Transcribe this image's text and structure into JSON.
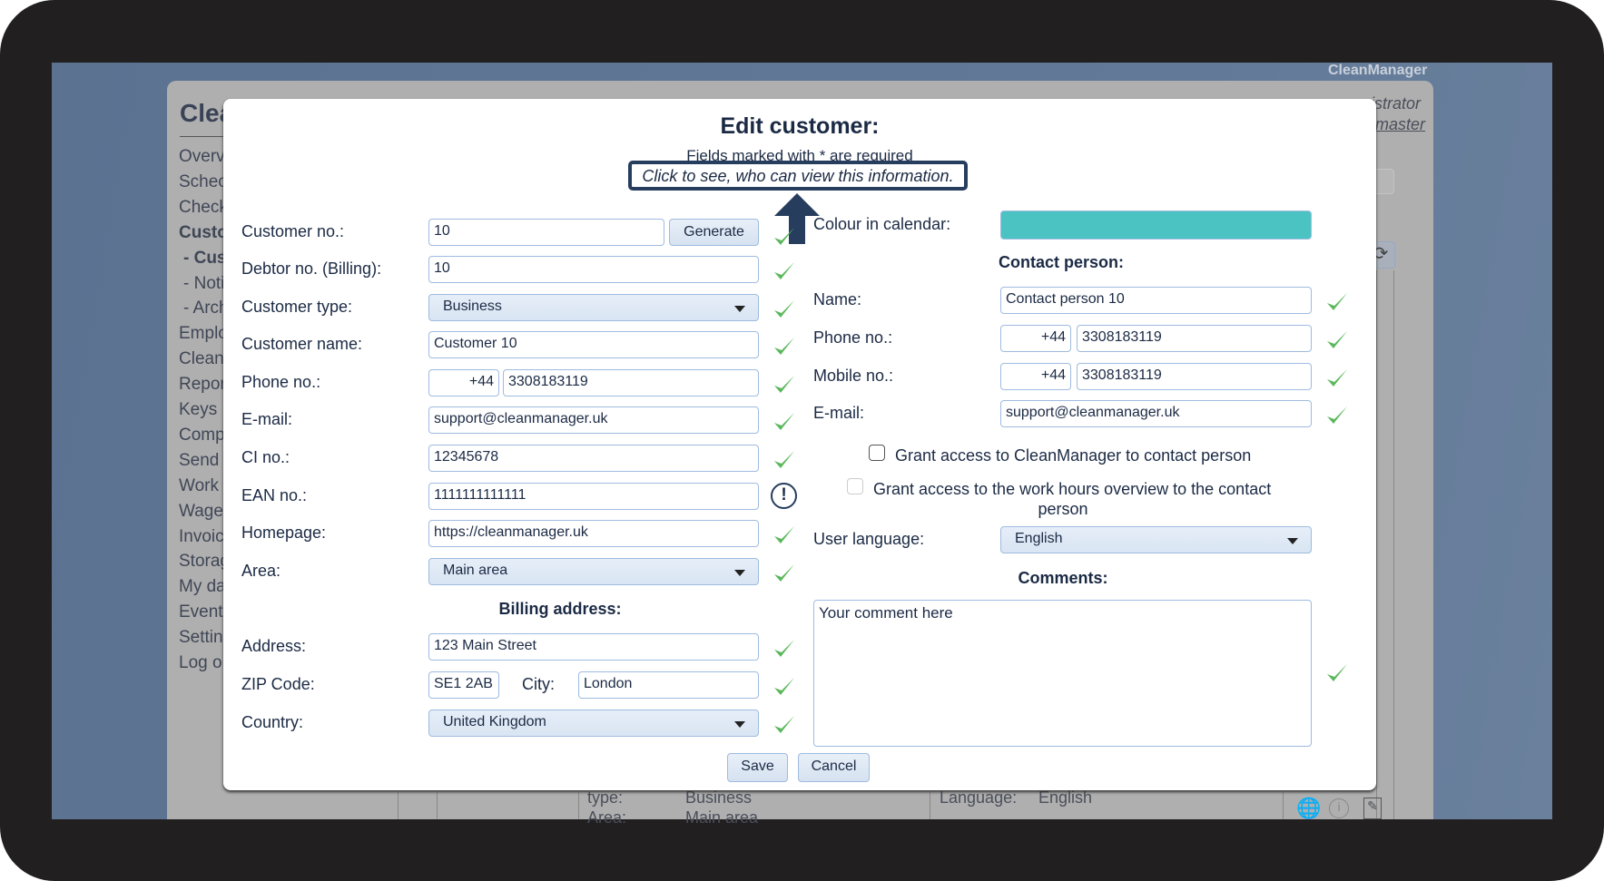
{
  "app": {
    "brand": "CleanManager",
    "window_title": "Clea",
    "user_line1": "istrator",
    "user_line2": "master"
  },
  "sidebar": {
    "items": [
      "Overv",
      "Schec",
      "Check",
      "Custo",
      "- Cus",
      "- Noti",
      "- Arch",
      "Emplo",
      "Clean",
      "Repor",
      "Keys",
      "Comp",
      "Send",
      "Work",
      "Wage",
      "Invoic",
      "Storag",
      "My da",
      "Event",
      "Settin",
      "Log o"
    ]
  },
  "background_row": {
    "type_label": "type:",
    "type_value": "Business",
    "area_label": "Area:",
    "area_value": "Main area",
    "language_label": "Language:",
    "language_value": "English"
  },
  "dialog": {
    "title": "Edit customer:",
    "subtitle": "Fields marked with * are required",
    "tooltip": "Click to see, who can view this information.",
    "left": {
      "customer_no": {
        "label": "Customer no.:",
        "value": "10",
        "button": "Generate"
      },
      "debtor_no": {
        "label": "Debtor no. (Billing):",
        "value": "10"
      },
      "customer_type": {
        "label": "Customer type:",
        "value": "Business"
      },
      "customer_name": {
        "label": "Customer name:",
        "value": "Customer 10"
      },
      "phone": {
        "label": "Phone no.:",
        "prefix": "+44",
        "value": "3308183119"
      },
      "email": {
        "label": "E-mail:",
        "value": "support@cleanmanager.uk"
      },
      "ci_no": {
        "label": "CI no.:",
        "value": "12345678"
      },
      "ean_no": {
        "label": "EAN no.:",
        "value": "1111111111111"
      },
      "homepage": {
        "label": "Homepage:",
        "value": "https://cleanmanager.uk"
      },
      "area": {
        "label": "Area:",
        "value": "Main area"
      },
      "billing_heading": "Billing address:",
      "address": {
        "label": "Address:",
        "value": "123 Main Street"
      },
      "zip": {
        "label": "ZIP Code:",
        "value": "SE1 2AB",
        "city_label": "City:",
        "city_value": "London"
      },
      "country": {
        "label": "Country:",
        "value": "United Kingdom"
      }
    },
    "right": {
      "colour": {
        "label": "Colour in calendar:",
        "value": "#4cc3c3"
      },
      "contact_heading": "Contact person:",
      "name": {
        "label": "Name:",
        "value": "Contact person 10"
      },
      "phone": {
        "label": "Phone no.:",
        "prefix": "+44",
        "value": "3308183119"
      },
      "mobile": {
        "label": "Mobile no.:",
        "prefix": "+44",
        "value": "3308183119"
      },
      "email": {
        "label": "E-mail:",
        "value": "support@cleanmanager.uk"
      },
      "grant_access": {
        "label": "Grant access to CleanManager to contact person",
        "checked": false
      },
      "grant_hours": {
        "label_line1": "Grant access to the work hours overview to the contact",
        "label_line2": "person",
        "checked": false,
        "disabled": true
      },
      "language": {
        "label": "User language:",
        "value": "English"
      },
      "comments_heading": "Comments:",
      "comments": "Your comment here"
    },
    "save": "Save",
    "cancel": "Cancel"
  },
  "colors": {
    "valid_check": "#5cb85c",
    "accent_dark": "#263d5e",
    "input_border": "#9fbbe0"
  }
}
